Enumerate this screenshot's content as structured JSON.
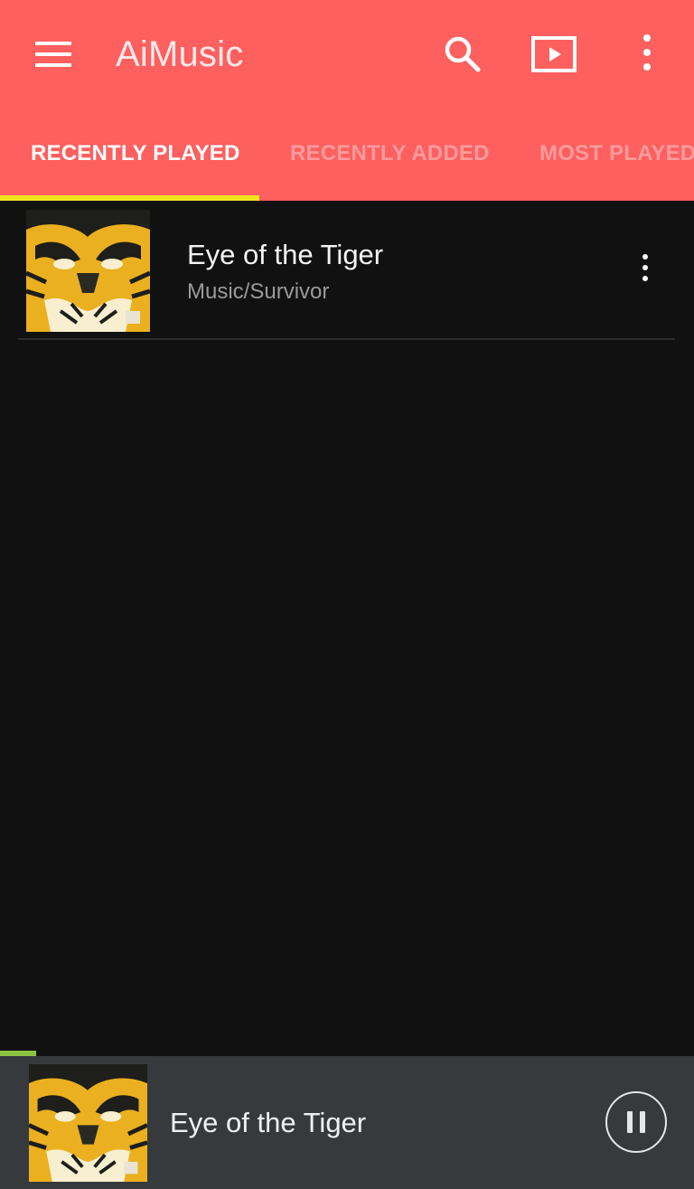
{
  "app": {
    "title": "AiMusic"
  },
  "toolbar": {
    "menu_icon": "hamburger-menu-icon",
    "search_icon": "search-icon",
    "play_queue_icon": "play-queue-icon",
    "more_icon": "more-vert-icon"
  },
  "tabs": [
    {
      "label": "RECENTLY PLAYED",
      "active": true
    },
    {
      "label": "RECENTLY ADDED",
      "active": false
    },
    {
      "label": "MOST PLAYED",
      "active": false
    }
  ],
  "tracks": [
    {
      "title": "Eye of the Tiger",
      "subtitle": "Music/Survivor",
      "art_icon": "album-art-tiger"
    }
  ],
  "now_playing": {
    "title": "Eye of the Tiger",
    "progress": 0.052,
    "state_icon": "pause-icon",
    "art_icon": "album-art-tiger"
  },
  "colors": {
    "app_bar": "#fe5f5f",
    "tab_indicator": "#f5e41d",
    "background": "#111111",
    "player_bar": "#373a3d",
    "progress": "#8bc53f"
  }
}
